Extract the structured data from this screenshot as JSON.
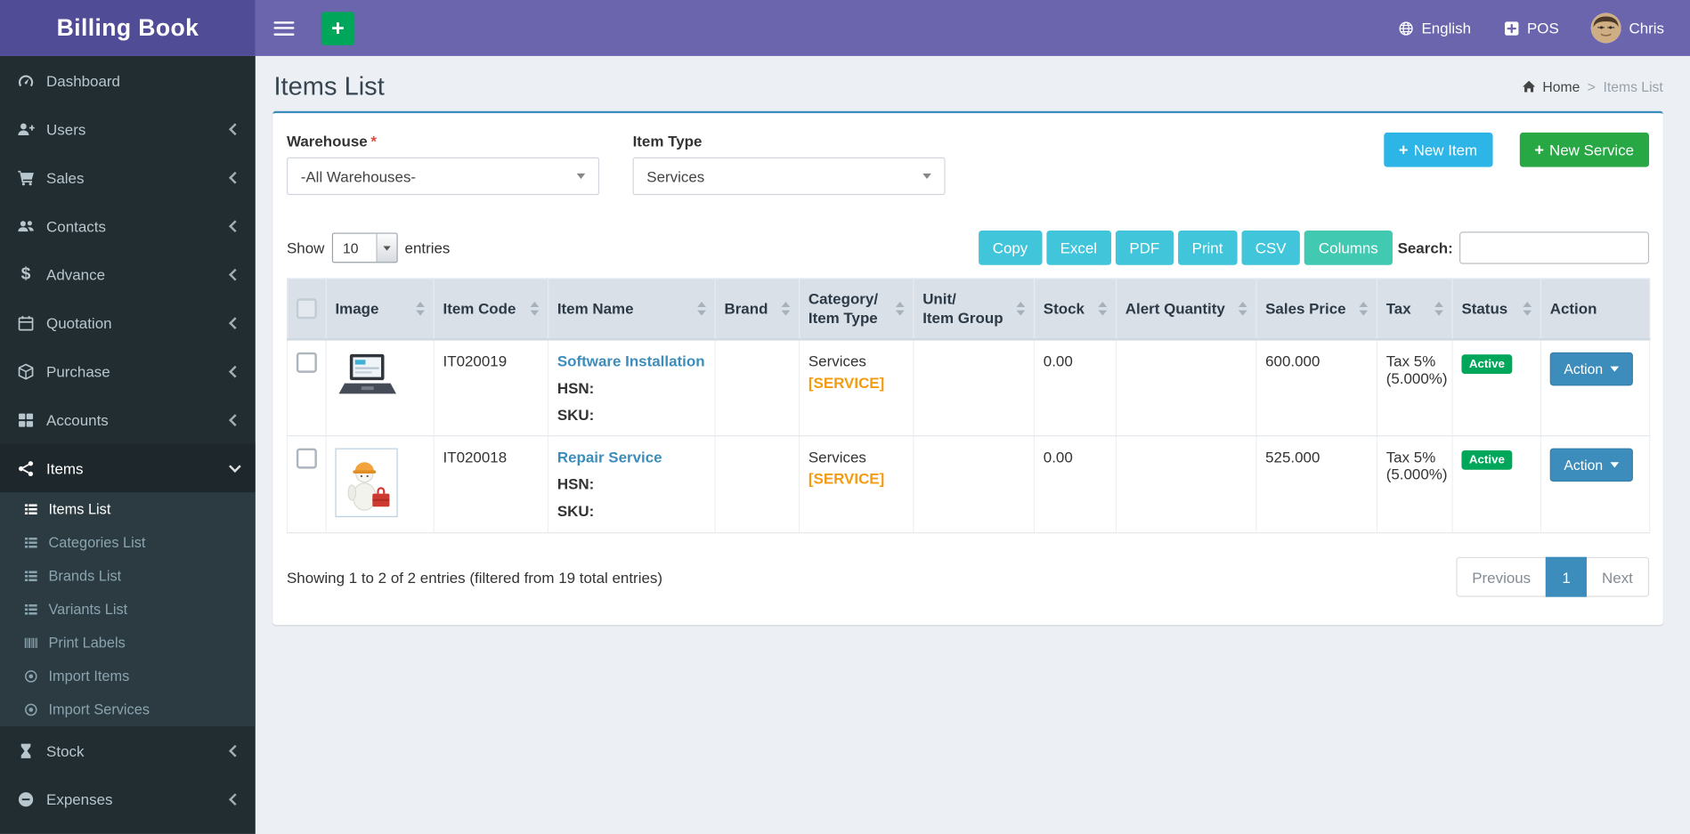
{
  "colors": {
    "navbar": "#6a65ad",
    "logo_background": "#514c96",
    "sidebar": "#222d32",
    "sidebar_submenu": "#2c3b41",
    "accent_blue": "#3c8dbc",
    "info_button": "#2db5e8",
    "success_button": "#28a745",
    "quick_add_green": "#00a65a",
    "export_button_teal": "#41c5da",
    "active_badge_green": "#00a65a",
    "service_tag_orange": "#f39c12",
    "content_background": "#ecf0f5"
  },
  "app": {
    "title": "Billing Book"
  },
  "topbar": {
    "quick_add_label": "+",
    "language": "English",
    "pos": "POS",
    "username": "Chris"
  },
  "sidebar": {
    "items": [
      {
        "label": "Dashboard",
        "icon": "dashboard-icon"
      },
      {
        "label": "Users",
        "icon": "user-plus-icon"
      },
      {
        "label": "Sales",
        "icon": "cart-icon"
      },
      {
        "label": "Contacts",
        "icon": "people-icon"
      },
      {
        "label": "Advance",
        "icon": "dollar-icon"
      },
      {
        "label": "Quotation",
        "icon": "calendar-icon"
      },
      {
        "label": "Purchase",
        "icon": "cube-icon"
      },
      {
        "label": "Accounts",
        "icon": "grid-icon"
      },
      {
        "label": "Items",
        "icon": "share-nodes-icon",
        "active": true,
        "expanded": true
      },
      {
        "label": "Stock",
        "icon": "hourglass-icon"
      },
      {
        "label": "Expenses",
        "icon": "minus-circle-icon"
      }
    ],
    "items_submenu": [
      {
        "label": "Items List",
        "icon": "list-icon",
        "active": true
      },
      {
        "label": "Categories List",
        "icon": "list-icon"
      },
      {
        "label": "Brands List",
        "icon": "list-icon"
      },
      {
        "label": "Variants List",
        "icon": "list-icon"
      },
      {
        "label": "Print Labels",
        "icon": "barcode-icon"
      },
      {
        "label": "Import Items",
        "icon": "circle-dot-icon"
      },
      {
        "label": "Import Services",
        "icon": "circle-dot-icon"
      }
    ]
  },
  "page": {
    "title": "Items List",
    "breadcrumb_home": "Home",
    "breadcrumb_sep": ">",
    "breadcrumb_current": "Items List"
  },
  "filters": {
    "warehouse_label": "Warehouse",
    "required_mark": "*",
    "warehouse_value": "-All Warehouses-",
    "item_type_label": "Item Type",
    "item_type_value": "Services",
    "plus": "+",
    "new_item_label": "New Item",
    "new_service_label": "New Service"
  },
  "controls": {
    "show_label": "Show",
    "page_size": "10",
    "entries_label": "entries",
    "export_buttons": [
      "Copy",
      "Excel",
      "PDF",
      "Print",
      "CSV",
      "Columns"
    ],
    "search_label": "Search:",
    "search_value": ""
  },
  "table": {
    "headers": {
      "image": "Image",
      "item_code": "Item Code",
      "item_name": "Item Name",
      "brand": "Brand",
      "category_line1": "Category/",
      "category_line2": "Item Type",
      "unit_line1": "Unit/",
      "unit_line2": "Item Group",
      "stock": "Stock",
      "alert_quantity": "Alert Quantity",
      "sales_price": "Sales Price",
      "tax": "Tax",
      "status": "Status",
      "action": "Action"
    },
    "rows": [
      {
        "image": "software-installation-thumbnail",
        "item_code": "IT020019",
        "item_name": "Software Installation",
        "hsn_label": "HSN:",
        "sku_label": "SKU:",
        "brand": "",
        "category": "Services",
        "category_tag": "[SERVICE]",
        "unit_group": "",
        "stock": "0.00",
        "alert_quantity": "",
        "sales_price": "600.000",
        "tax": "Tax 5%",
        "tax_detail": "(5.000%)",
        "status": "Active",
        "action_label": "Action"
      },
      {
        "image": "repair-service-thumbnail",
        "item_code": "IT020018",
        "item_name": "Repair Service",
        "hsn_label": "HSN:",
        "sku_label": "SKU:",
        "brand": "",
        "category": "Services",
        "category_tag": "[SERVICE]",
        "unit_group": "",
        "stock": "0.00",
        "alert_quantity": "",
        "sales_price": "525.000",
        "tax": "Tax 5%",
        "tax_detail": "(5.000%)",
        "status": "Active",
        "action_label": "Action"
      }
    ]
  },
  "footer": {
    "summary": "Showing 1 to 2 of 2 entries (filtered from 19 total entries)",
    "previous": "Previous",
    "page": "1",
    "next": "Next"
  }
}
